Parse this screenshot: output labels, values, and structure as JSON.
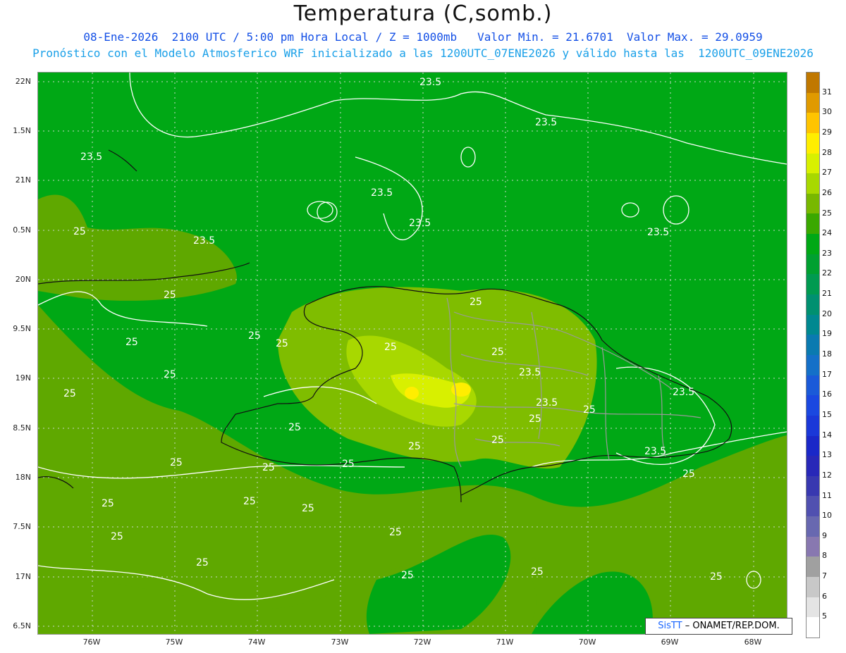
{
  "title": "Temperatura (C,somb.)",
  "subtitle_line1": "08-Ene-2026  2100 UTC / 5:00 pm Hora Local / Z = 1000mb   Valor Min. = 21.6701  Valor Max. = 29.0959",
  "subtitle_line2": "Pronóstico con el Modelo Atmosferico WRF inicializado a las 1200UTC_07ENE2026 y válido hasta las  1200UTC_09ENE2026",
  "lat_labels": [
    "22N",
    "1.5N",
    "21N",
    "0.5N",
    "20N",
    "9.5N",
    "19N",
    "8.5N",
    "18N",
    "7.5N",
    "17N",
    "6.5N"
  ],
  "lon_labels": [
    "76W",
    "75W",
    "74W",
    "73W",
    "72W",
    "71W",
    "70W",
    "69W",
    "68W"
  ],
  "colorbar": {
    "labels": [
      "31",
      "30",
      "29",
      "28",
      "27",
      "26",
      "25",
      "24",
      "23",
      "22",
      "21",
      "20",
      "19",
      "18",
      "17",
      "16",
      "15",
      "14",
      "13",
      "12",
      "11",
      "10",
      "9",
      "8",
      "7",
      "6",
      "5"
    ],
    "colors": [
      "#c07800",
      "#e09a00",
      "#ffc400",
      "#ffee00",
      "#d8f000",
      "#a8d800",
      "#78b800",
      "#3aa800",
      "#00a815",
      "#00a030",
      "#009a50",
      "#009070",
      "#008890",
      "#0a7ab0",
      "#1470c8",
      "#1a5ad8",
      "#1a48e0",
      "#1a38d8",
      "#1a28c8",
      "#2828b8",
      "#3838b0",
      "#5050b0",
      "#6868b0",
      "#8878b0",
      "#a0a0a0",
      "#c8c8c8",
      "#e4e4e4",
      "#ffffff"
    ]
  },
  "contour_labels": {
    "a": "23.5",
    "b": "25"
  },
  "credit": {
    "sis": "SisTT",
    "rest": "– ONAMET/REP.DOM."
  }
}
